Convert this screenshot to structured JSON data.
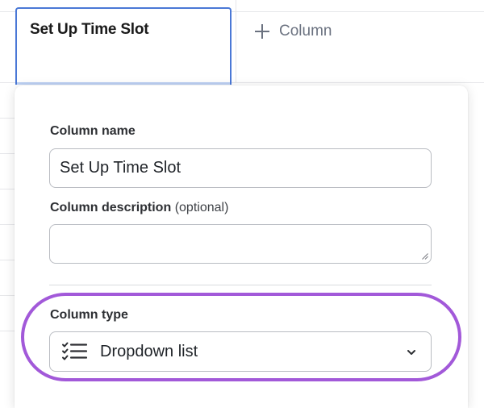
{
  "header_cell": {
    "title": "Set Up Time Slot"
  },
  "add_column": {
    "label": "Column"
  },
  "form": {
    "name_label": "Column name",
    "name_value": "Set Up Time Slot",
    "description_label": "Column description",
    "description_optional": "(optional)",
    "description_value": "",
    "type_label": "Column type",
    "type_value": "Dropdown list",
    "type_icon": "checklist-icon"
  },
  "colors": {
    "active_border": "#4a78d6",
    "highlight_ring": "#a259d9",
    "muted_text": "#6b7280"
  }
}
